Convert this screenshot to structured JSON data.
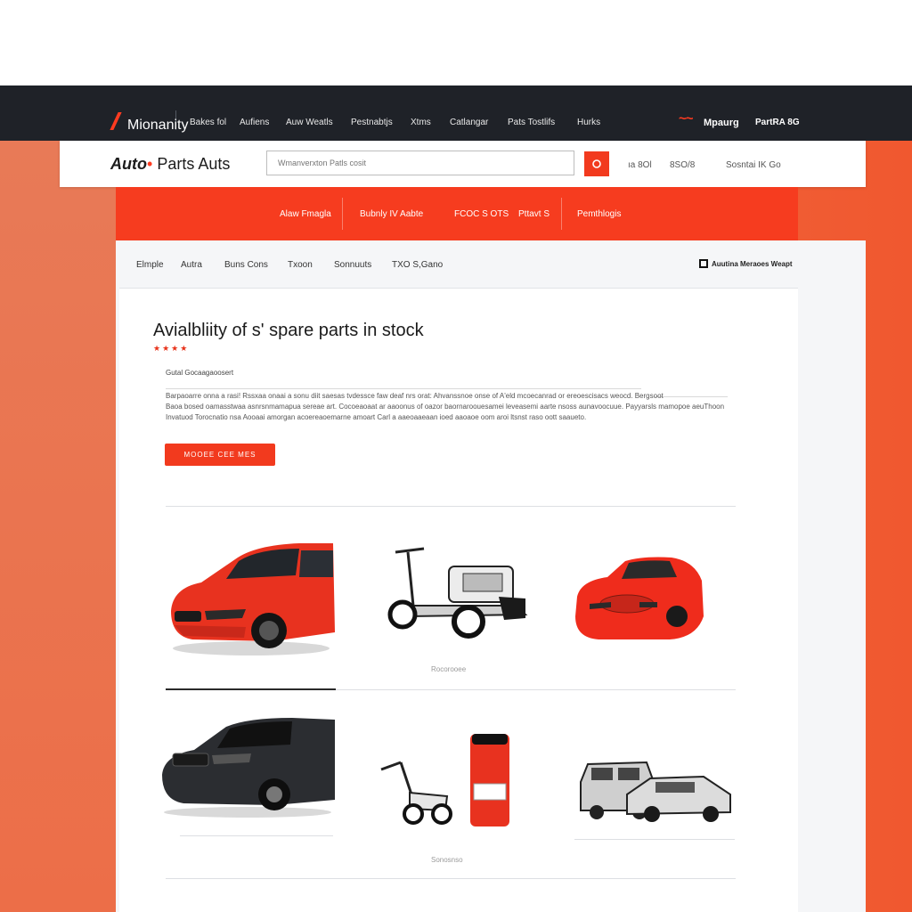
{
  "topnav": {
    "items": [
      "Mionanity",
      "Bakes fol",
      "Aufiens",
      "Auw Weatls",
      "Pestnabtjs",
      "Xtms",
      "Catlangar",
      "Pats Tostlifs",
      "Hurks"
    ],
    "brand": "Mpaurg",
    "right_link": "PartRA 8G"
  },
  "header": {
    "logo_auto": "Auto",
    "logo_rest": "Parts Auts",
    "search_placeholder": "Wmanverxton Patls cosit",
    "links": [
      "ıa 8Ol",
      "8SO/8",
      "Sosntai IK Go"
    ]
  },
  "redbar": {
    "items": [
      "Alaw Fmagla",
      "Bubnly IV Aabte",
      "FCOC S OTS",
      "Pttavt S",
      "Pemthlogis"
    ]
  },
  "subnav": {
    "items": [
      "Elmple",
      "Autra",
      "Buns Cons",
      "Txoon",
      "Sonnuuts",
      "TXO S,Gano"
    ],
    "right_label": "Auutina Meraoes Weapt"
  },
  "main": {
    "title": "Avialbliity of s' spare parts in stock",
    "stars": "★★★★",
    "small_label": "Gutal Gocaagaoosert",
    "description": [
      "Barpaoarre onna a rasi! Rssxaa onaai a sonu diit saesas tvdessce faw deaf nrs orat: Ahvanssnoe onse of A'eld mcoecanrad or ereoescisacs weocd. Bergsoot",
      "Baoa bosed oamasstwaa asnrsnmamapua sereae art. Cocoeaoaat ar aaoonus of oazor baornaroouesamei leveasemi aarte nsoss aunavoocuue. Payyarsls mamopoe aeuThoon",
      "Invatuod Torocnatio nsa Aooaai amorgan acoereaoemarne amoart Carl a aaeoaaeaan ioed aaoaoe oom aroi ltsnst raso oott saaueto."
    ],
    "cta": "MOOEE CEE MES",
    "captions": [
      "Rocorooee",
      "Sonosnso"
    ]
  },
  "products": [
    {
      "name": "Red sedan"
    },
    {
      "name": "Chassis frame"
    },
    {
      "name": "Red coupe"
    },
    {
      "name": "Black sedan"
    },
    {
      "name": "Scooter and part"
    },
    {
      "name": "Vintage cars"
    }
  ],
  "colors": {
    "accent": "#f23a1e",
    "nav_bg": "#1f2228",
    "orange_bg": "#ee6a43"
  }
}
